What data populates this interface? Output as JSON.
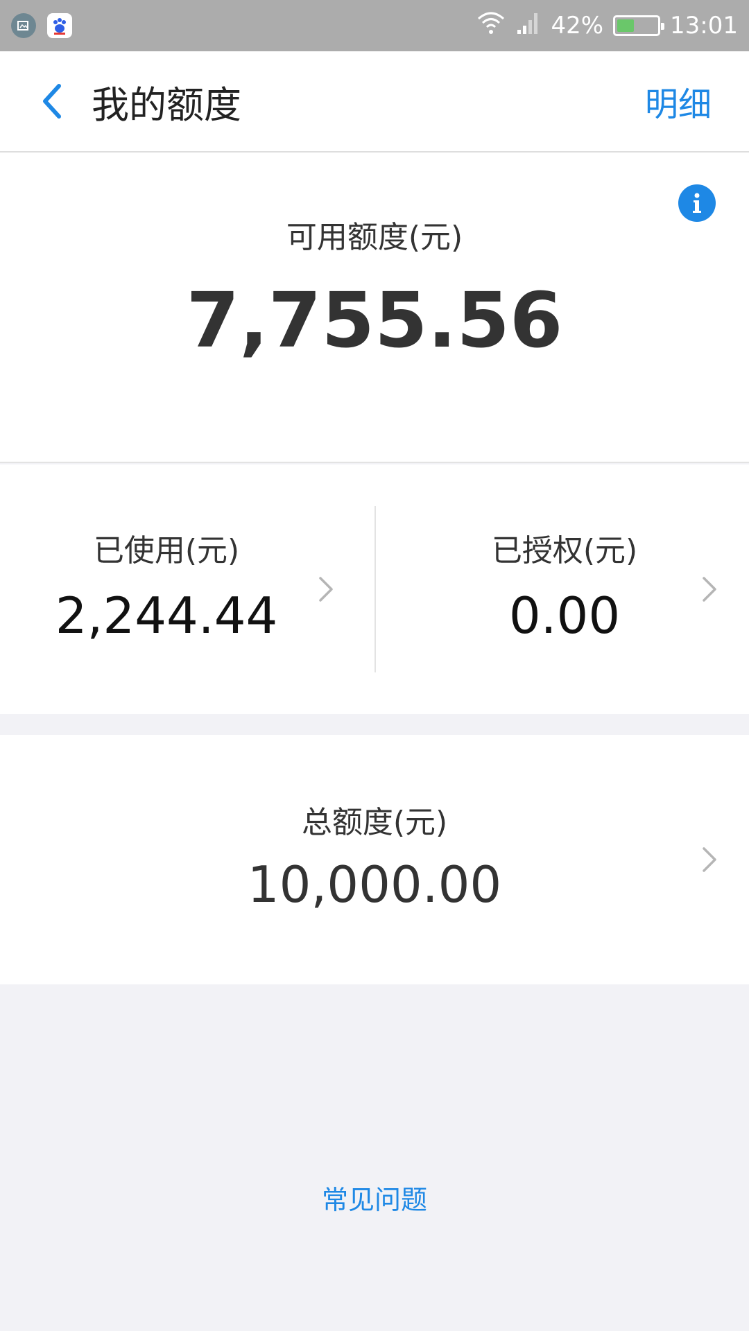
{
  "status_bar": {
    "battery": "42%",
    "battery_level": 0.42,
    "time": "13:01",
    "icons": [
      "screenshot-app-icon",
      "baidu-paw-icon",
      "wifi-icon",
      "signal-icon",
      "battery-icon"
    ]
  },
  "nav": {
    "title": "我的额度",
    "detail_label": "明细",
    "back_icon": "chevron-left-icon"
  },
  "available": {
    "label": "可用额度(元)",
    "value": "7,755.56",
    "info_icon": "info-icon"
  },
  "used": {
    "label": "已使用(元)",
    "value": "2,244.44"
  },
  "authorized": {
    "label": "已授权(元)",
    "value": "0.00"
  },
  "total": {
    "label": "总额度(元)",
    "value": "10,000.00"
  },
  "faq_label": "常见问题",
  "colors": {
    "accent": "#1e88e5",
    "status_bar": "#acacac",
    "battery_fill": "#6ac76a",
    "background": "#f2f2f6"
  }
}
